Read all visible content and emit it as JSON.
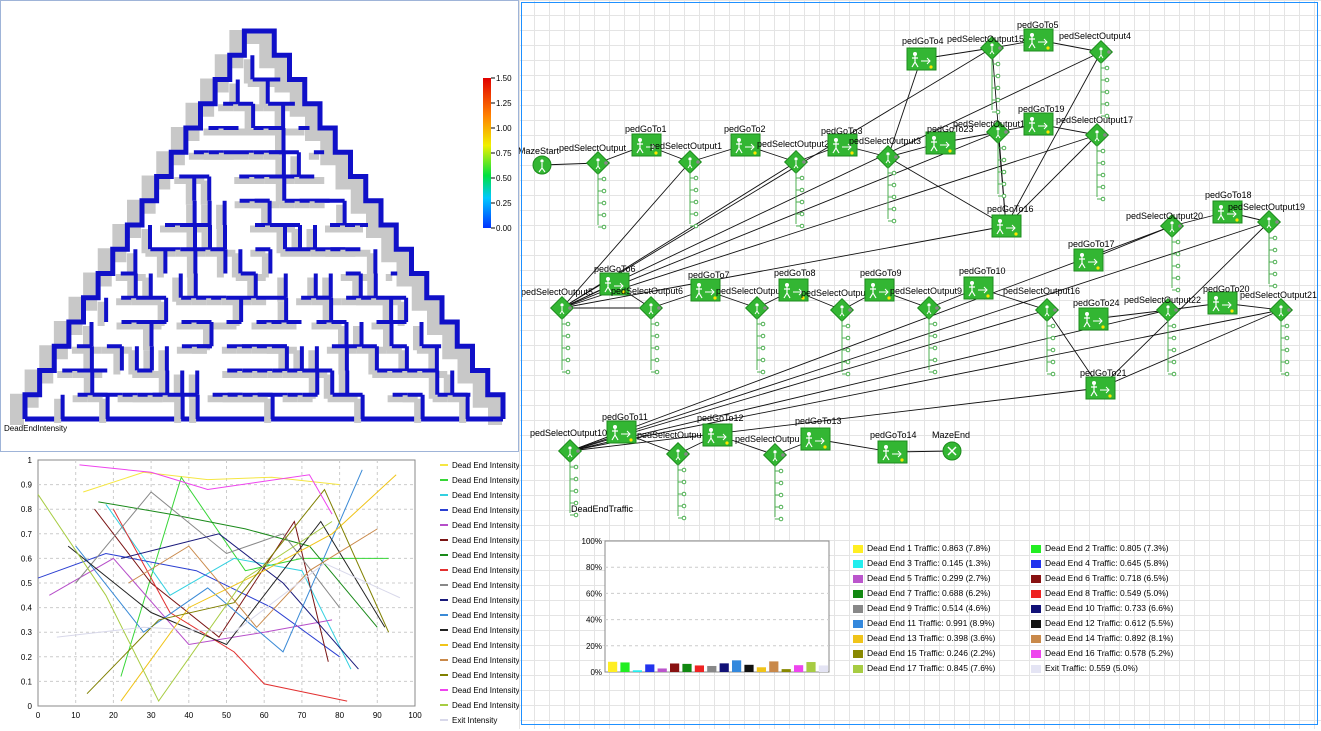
{
  "maze": {
    "label": "DeadEndIntensity",
    "scale_ticks": [
      "1.50",
      "1.25",
      "1.00",
      "0.75",
      "0.50",
      "0.25",
      "0.00"
    ],
    "colors": {
      "wall": "#1010c8",
      "shadow": "#c8c8c8"
    }
  },
  "flow": {
    "nodes": [
      {
        "id": "MazeStart",
        "type": "source"
      },
      {
        "id": "pedSelectOutput",
        "type": "select"
      },
      {
        "id": "pedGoTo1",
        "type": "goto"
      },
      {
        "id": "pedSelectOutput1",
        "type": "select"
      },
      {
        "id": "pedGoTo2",
        "type": "goto"
      },
      {
        "id": "pedSelectOutput2",
        "type": "select",
        "label": "pedSelectOutput2"
      },
      {
        "id": "pedGoTo3",
        "type": "goto"
      },
      {
        "id": "pedSelectOutput3",
        "type": "select"
      },
      {
        "id": "pedGoTo23",
        "type": "goto",
        "label": "pedGoTo23"
      },
      {
        "id": "pedSelectOutput18",
        "type": "select",
        "label": "pedSelectOutput1"
      },
      {
        "id": "pedGoTo19",
        "type": "goto"
      },
      {
        "id": "pedSelectOutput17",
        "type": "select"
      },
      {
        "id": "pedGoTo4",
        "type": "goto"
      },
      {
        "id": "pedSelectOutput15",
        "type": "select"
      },
      {
        "id": "pedGoTo5",
        "type": "goto"
      },
      {
        "id": "pedSelectOutput4",
        "type": "select"
      },
      {
        "id": "pedGoTo16",
        "type": "goto"
      },
      {
        "id": "pedSelectOutput5",
        "type": "select"
      },
      {
        "id": "pedGoTo6",
        "type": "goto"
      },
      {
        "id": "pedSelectOutput6",
        "type": "select"
      },
      {
        "id": "pedGoTo7",
        "type": "goto"
      },
      {
        "id": "pedSelectOutput7",
        "type": "select",
        "label": "pedSelectOutpu"
      },
      {
        "id": "pedGoTo8",
        "type": "goto"
      },
      {
        "id": "pedSelectOutput8",
        "type": "select",
        "label": "pedSelectOutput"
      },
      {
        "id": "pedGoTo9",
        "type": "goto"
      },
      {
        "id": "pedSelectOutput9",
        "type": "select"
      },
      {
        "id": "pedGoTo10",
        "type": "goto"
      },
      {
        "id": "pedSelectOutput16",
        "type": "select"
      },
      {
        "id": "pedGoTo17",
        "type": "goto"
      },
      {
        "id": "pedSelectOutput20",
        "type": "select"
      },
      {
        "id": "pedGoTo18",
        "type": "goto"
      },
      {
        "id": "pedSelectOutput19",
        "type": "select"
      },
      {
        "id": "pedGoTo24",
        "type": "goto"
      },
      {
        "id": "pedSelectOutput22",
        "type": "select"
      },
      {
        "id": "pedGoTo20",
        "type": "goto"
      },
      {
        "id": "pedSelectOutput21",
        "type": "select"
      },
      {
        "id": "pedGoTo21",
        "type": "goto"
      },
      {
        "id": "pedSelectOutput10",
        "type": "select"
      },
      {
        "id": "pedGoTo11",
        "type": "goto"
      },
      {
        "id": "pedSelectOutput11",
        "type": "select",
        "label": "pedSelectOutpu"
      },
      {
        "id": "pedGoTo12",
        "type": "goto"
      },
      {
        "id": "pedSelectOutput12",
        "type": "select",
        "label": "pedSelectOutpu"
      },
      {
        "id": "pedGoTo13",
        "type": "goto"
      },
      {
        "id": "pedGoTo14",
        "type": "goto"
      },
      {
        "id": "MazeEnd",
        "type": "sink"
      }
    ],
    "dataset_label": "DeadEndTraffic"
  },
  "line_chart": {
    "x_ticks": [
      "0",
      "10",
      "20",
      "30",
      "40",
      "50",
      "60",
      "70",
      "80",
      "90",
      "100"
    ],
    "y_ticks": [
      "0",
      "0.1",
      "0.2",
      "0.3",
      "0.4",
      "0.5",
      "0.6",
      "0.7",
      "0.8",
      "0.9",
      "1"
    ]
  },
  "bar_chart": {
    "y_ticks": [
      "100%",
      "80%",
      "60%",
      "40%",
      "20%",
      "0%"
    ]
  },
  "chart_data": [
    {
      "type": "line",
      "xlim": [
        0,
        100
      ],
      "ylim": [
        0,
        1
      ],
      "grid": true,
      "legend_placement": "right",
      "series": [
        {
          "name": "Dead End Intensity 1",
          "color": "#f5e642",
          "x": [
            12,
            28,
            45,
            62,
            80
          ],
          "y": [
            0.87,
            0.95,
            0.92,
            0.93,
            0.9
          ]
        },
        {
          "name": "Dead End Intensity 2",
          "color": "#37d637",
          "x": [
            22,
            38,
            55,
            70,
            93
          ],
          "y": [
            0.12,
            0.93,
            0.55,
            0.6,
            0.6
          ]
        },
        {
          "name": "Dead End Intensity 3",
          "color": "#33d0e0",
          "x": [
            18,
            35,
            52,
            70,
            83
          ],
          "y": [
            0.82,
            0.45,
            0.6,
            0.55,
            0.15
          ]
        },
        {
          "name": "Dead End Intensity 4",
          "color": "#2b3fd1",
          "x": [
            0,
            18,
            42,
            62,
            80
          ],
          "y": [
            0.52,
            0.62,
            0.55,
            0.4,
            0.2
          ]
        },
        {
          "name": "Dead End Intensity 5",
          "color": "#b64ec9",
          "x": [
            3,
            20,
            40,
            60,
            78
          ],
          "y": [
            0.45,
            0.6,
            0.25,
            0.3,
            0.35
          ]
        },
        {
          "name": "Dead End Intensity 6",
          "color": "#7a1414",
          "x": [
            15,
            30,
            48,
            68,
            77
          ],
          "y": [
            0.8,
            0.5,
            0.28,
            0.75,
            0.18
          ]
        },
        {
          "name": "Dead End Intensity 7",
          "color": "#1a8a1a",
          "x": [
            16,
            35,
            55,
            72,
            90
          ],
          "y": [
            0.83,
            0.78,
            0.72,
            0.65,
            0.32
          ]
        },
        {
          "name": "Dead End Intensity 8",
          "color": "#e23030",
          "x": [
            20,
            35,
            52,
            60,
            82
          ],
          "y": [
            0.8,
            0.38,
            0.22,
            0.09,
            0.02
          ]
        },
        {
          "name": "Dead End Intensity 9",
          "color": "#888888",
          "x": [
            10,
            30,
            50,
            65,
            80
          ],
          "y": [
            0.5,
            0.87,
            0.62,
            0.7,
            0.4
          ]
        },
        {
          "name": "Dead End Intensity 10",
          "color": "#1a1a7a",
          "x": [
            22,
            35,
            48,
            65,
            85
          ],
          "y": [
            0.6,
            0.65,
            0.7,
            0.5,
            0.15
          ]
        },
        {
          "name": "Dead End Intensity 11",
          "color": "#3a8ad6",
          "x": [
            10,
            28,
            45,
            65,
            86
          ],
          "y": [
            0.65,
            0.3,
            0.48,
            0.22,
            0.96
          ]
        },
        {
          "name": "Dead End Intensity 12",
          "color": "#222222",
          "x": [
            8,
            30,
            50,
            75,
            92
          ],
          "y": [
            0.65,
            0.38,
            0.25,
            0.75,
            0.32
          ]
        },
        {
          "name": "Dead End Intensity 13",
          "color": "#f0c419",
          "x": [
            22,
            40,
            60,
            78,
            95
          ],
          "y": [
            0.02,
            0.4,
            0.55,
            0.7,
            0.94
          ]
        },
        {
          "name": "Dead End Intensity 14",
          "color": "#c9894a",
          "x": [
            24,
            40,
            58,
            72,
            90
          ],
          "y": [
            0.5,
            0.65,
            0.32,
            0.55,
            0.72
          ]
        },
        {
          "name": "Dead End Intensity 15",
          "color": "#808000",
          "x": [
            13,
            32,
            52,
            76,
            93
          ],
          "y": [
            0.05,
            0.35,
            0.42,
            0.88,
            0.3
          ]
        },
        {
          "name": "Dead End Intensity 16",
          "color": "#ee44ee",
          "x": [
            11,
            30,
            45,
            72,
            78
          ],
          "y": [
            0.98,
            0.95,
            0.88,
            0.94,
            0.78
          ]
        },
        {
          "name": "Dead End Intensity 17",
          "color": "#a7cc42",
          "x": [
            0,
            18,
            32,
            55,
            78
          ],
          "y": [
            0.86,
            0.45,
            0.02,
            0.52,
            0.75
          ]
        },
        {
          "name": "Exit Intensity",
          "color": "#d8d8ea",
          "x": [
            5,
            28,
            52,
            76,
            96
          ],
          "y": [
            0.28,
            0.32,
            0.3,
            0.58,
            0.44
          ]
        }
      ]
    },
    {
      "type": "bar",
      "ylim": [
        0,
        100
      ],
      "y_unit": "%",
      "categories": [
        "Dead End 1 Traffic",
        "Dead End 2 Traffic",
        "Dead End 3 Traffic",
        "Dead End 4 Traffic",
        "Dead End 5 Traffic",
        "Dead End 6 Traffic",
        "Dead End 7 Traffic",
        "Dead End 8 Traffic",
        "Dead End 9 Traffic",
        "Dead End 10 Traffic",
        "Dead End 11 Traffic",
        "Dead End 12 Traffic",
        "Dead End 13 Traffic",
        "Dead End 14 Traffic",
        "Dead End 15 Traffic",
        "Dead End 16 Traffic",
        "Dead End 17 Traffic",
        "Exit Traffic"
      ],
      "values": [
        7.8,
        7.3,
        1.3,
        5.8,
        2.7,
        6.5,
        6.2,
        5.0,
        4.6,
        6.6,
        8.9,
        5.5,
        3.6,
        8.1,
        2.2,
        5.2,
        7.6,
        5.0
      ],
      "raw_values": [
        0.863,
        0.805,
        0.145,
        0.645,
        0.299,
        0.718,
        0.688,
        0.549,
        0.514,
        0.733,
        0.991,
        0.612,
        0.398,
        0.892,
        0.246,
        0.578,
        0.845,
        0.559
      ],
      "colors": [
        "#ffee22",
        "#22ee22",
        "#22eeee",
        "#2233ee",
        "#bb55cc",
        "#881111",
        "#118811",
        "#ee2222",
        "#888888",
        "#111177",
        "#3388dd",
        "#111111",
        "#f0c419",
        "#c9894a",
        "#888800",
        "#ee44ee",
        "#a7cc42",
        "#e4e4f4"
      ],
      "legend": [
        "Dead End 1 Traffic: 0.863 (7.8%)",
        "Dead End 2 Traffic: 0.805 (7.3%)",
        "Dead End 3 Traffic: 0.145 (1.3%)",
        "Dead End 4 Traffic: 0.645 (5.8%)",
        "Dead End 5 Traffic: 0.299 (2.7%)",
        "Dead End 6 Traffic: 0.718 (6.5%)",
        "Dead End 7 Traffic: 0.688 (6.2%)",
        "Dead End 8 Traffic: 0.549 (5.0%)",
        "Dead End 9 Traffic: 0.514 (4.6%)",
        "Dead End 10 Traffic: 0.733 (6.6%)",
        "Dead End 11 Traffic: 0.991 (8.9%)",
        "Dead End 12 Traffic: 0.612 (5.5%)",
        "Dead End 13 Traffic: 0.398 (3.6%)",
        "Dead End 14 Traffic: 0.892 (8.1%)",
        "Dead End 15 Traffic: 0.246 (2.2%)",
        "Dead End 16 Traffic: 0.578 (5.2%)",
        "Dead End 17 Traffic: 0.845 (7.6%)",
        "Exit Traffic: 0.559 (5.0%)"
      ]
    }
  ]
}
